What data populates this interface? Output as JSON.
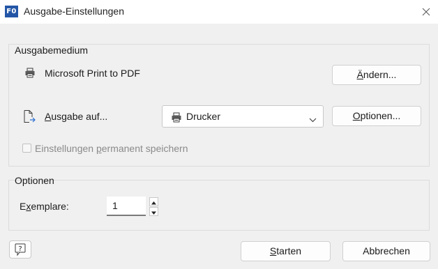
{
  "window": {
    "title": "Ausgabe-Einstellungen",
    "app_icon_text": "F0"
  },
  "output_group": {
    "title": "Ausgabemedium",
    "printer_name": "Microsoft Print to PDF",
    "change_button": {
      "prefix": "",
      "accel": "Ä",
      "rest": "ndern..."
    },
    "output_label": {
      "prefix": "",
      "accel": "A",
      "rest": "usgabe auf..."
    },
    "output_select_value": "Drucker",
    "options_button": {
      "prefix": "",
      "accel": "O",
      "rest": "ptionen..."
    },
    "save_checkbox": {
      "prefix": "Einstellungen ",
      "accel": "p",
      "rest": "ermanent speichern",
      "checked": false
    }
  },
  "options_group": {
    "title": "Optionen",
    "copies_label": {
      "prefix": "E",
      "accel": "x",
      "rest": "emplare:"
    },
    "copies_value": "1"
  },
  "footer": {
    "start_button": {
      "prefix": "",
      "accel": "S",
      "rest": "tarten"
    },
    "cancel_button": "Abbrechen"
  },
  "icons": {
    "app": "app-logo-icon",
    "close": "close-icon",
    "printer": "printer-icon",
    "output": "document-output-icon",
    "dropdown": "chevron-down-icon",
    "spin_up": "spin-up-icon",
    "spin_down": "spin-down-icon",
    "help": "help-icon"
  },
  "colors": {
    "accent": "#2356a6",
    "background": "#f0f0f0"
  }
}
